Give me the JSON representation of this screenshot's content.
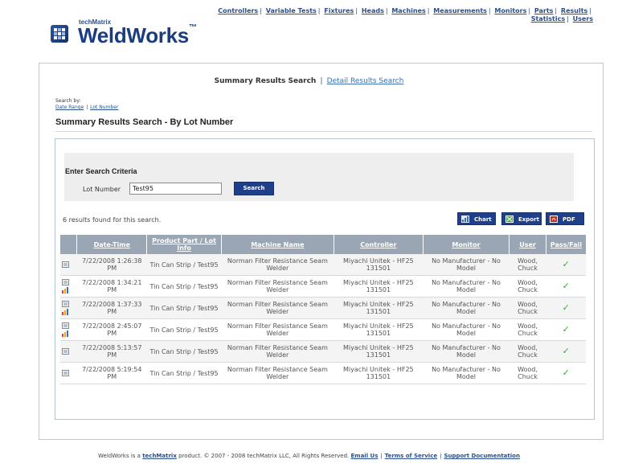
{
  "topnav": {
    "items": [
      "Controllers",
      "Variable Tests",
      "Fixtures",
      "Heads",
      "Machines",
      "Measurements",
      "Monitors",
      "Parts",
      "Results",
      "Statistics",
      "Users"
    ]
  },
  "logo": {
    "small": "techMatrix",
    "big": "WeldWorks",
    "tm": "™"
  },
  "tabs": {
    "active": "Summary Results Search",
    "other": "Detail Results Search",
    "sep": "|"
  },
  "search_by": {
    "label": "Search by:",
    "options": [
      "Date Range",
      "Lot Number"
    ],
    "sep": "|"
  },
  "page_heading": "Summary Results Search - By Lot Number",
  "criteria": {
    "title": "Enter Search Criteria",
    "lot_label": "Lot Number",
    "lot_value": "Test95",
    "search_button": "Search"
  },
  "results": {
    "found_text": "6 results found for this search.",
    "buttons": {
      "chart": "Chart",
      "export": "Export",
      "pdf": "PDF"
    },
    "columns": [
      "Date-Time",
      "Product Part / Lot Info",
      "Machine Name",
      "Controller",
      "Monitor",
      "User",
      "Pass/Fail"
    ],
    "rows": [
      {
        "date": "7/22/2008 1:26:38 PM",
        "part": "Tin Can Strip / Test95",
        "machine": "Norman Filter Resistance Seam Welder",
        "controller": "Miyachi Unitek - HF25 131501",
        "monitor": "No Manufacturer - No Model",
        "user": "Wood, Chuck",
        "pass": "✓",
        "has_chart": false
      },
      {
        "date": "7/22/2008 1:34:21 PM",
        "part": "Tin Can Strip / Test95",
        "machine": "Norman Filter Resistance Seam Welder",
        "controller": "Miyachi Unitek - HF25 131501",
        "monitor": "No Manufacturer - No Model",
        "user": "Wood, Chuck",
        "pass": "✓",
        "has_chart": true
      },
      {
        "date": "7/22/2008 1:37:33 PM",
        "part": "Tin Can Strip / Test95",
        "machine": "Norman Filter Resistance Seam Welder",
        "controller": "Miyachi Unitek - HF25 131501",
        "monitor": "No Manufacturer - No Model",
        "user": "Wood, Chuck",
        "pass": "✓",
        "has_chart": true
      },
      {
        "date": "7/22/2008 2:45:07 PM",
        "part": "Tin Can Strip / Test95",
        "machine": "Norman Filter Resistance Seam Welder",
        "controller": "Miyachi Unitek - HF25 131501",
        "monitor": "No Manufacturer - No Model",
        "user": "Wood, Chuck",
        "pass": "✓",
        "has_chart": true
      },
      {
        "date": "7/22/2008 5:13:57 PM",
        "part": "Tin Can Strip / Test95",
        "machine": "Norman Filter Resistance Seam Welder",
        "controller": "Miyachi Unitek - HF25 131501",
        "monitor": "No Manufacturer - No Model",
        "user": "Wood, Chuck",
        "pass": "✓",
        "has_chart": false
      },
      {
        "date": "7/22/2008 5:19:54 PM",
        "part": "Tin Can Strip / Test95",
        "machine": "Norman Filter Resistance Seam Welder",
        "controller": "Miyachi Unitek - HF25 131501",
        "monitor": "No Manufacturer - No Model",
        "user": "Wood, Chuck",
        "pass": "✓",
        "has_chart": false
      }
    ]
  },
  "footer": {
    "text1": "WeldWorks is a",
    "brand": "techMatrix",
    "text2": "product. © 2007 - 2008 techMatrix LLC, All Rights Reserved.",
    "links": [
      "Email Us",
      "Terms of Service",
      "Support Documentation"
    ]
  },
  "colors": {
    "brand_blue": "#1f3f8a",
    "link_blue": "#2a4f8a",
    "header_gray": "#9aa6b4",
    "pass_green": "#3aa83a"
  }
}
